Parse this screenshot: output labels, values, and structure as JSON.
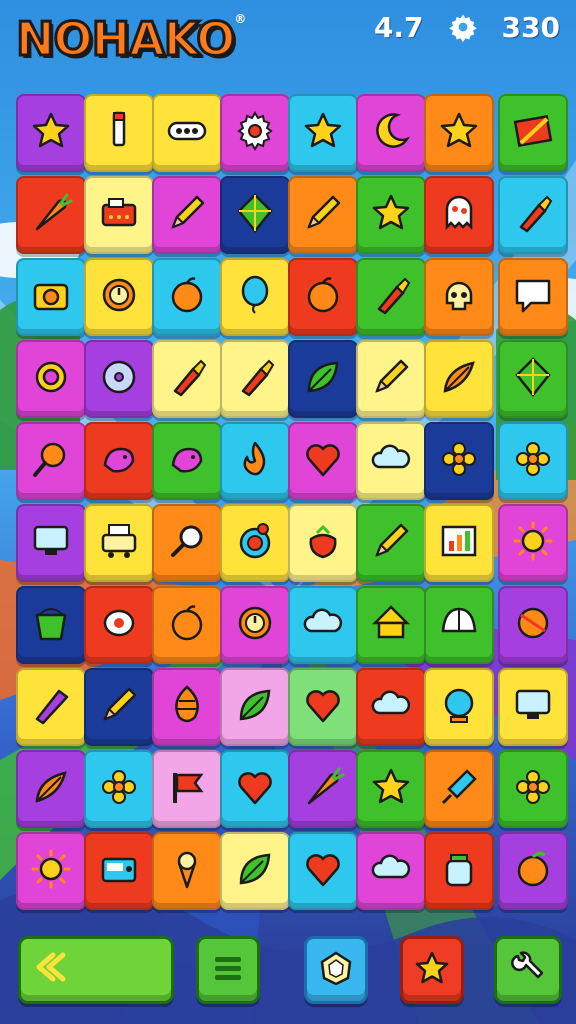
{
  "header": {
    "logo_text": "NOHAKO",
    "logo_mark": "®",
    "rating": "4.7",
    "score": "330",
    "settings_icon": "gear-icon"
  },
  "colors": {
    "purple": "#a63fe0",
    "yellow": "#ffe23a",
    "teal": "#2ec7ee",
    "orange": "#ff8a18",
    "green": "#3fc12c",
    "red": "#ee3a1f",
    "magenta": "#e045d8",
    "navy": "#1b3b9a",
    "pale": "#fff48a",
    "pink": "#f2a6e8",
    "lightgreen": "#7fe07a"
  },
  "board": {
    "rows": [
      [
        "star",
        "pencil-yellow",
        "dots",
        "gear",
        "star",
        "moon",
        "star",
        "dash-pencil"
      ],
      [
        "carrot",
        "box",
        "pencil",
        "kite",
        "pencil",
        "star",
        "ghost",
        "brush"
      ],
      [
        "camera",
        "clock",
        "apple",
        "balloon",
        "apple",
        "brush",
        "skull",
        "speech"
      ],
      [
        "ring",
        "cd",
        "brush",
        "brush",
        "leaf",
        "pencil",
        "feather",
        "kite"
      ],
      [
        "racket",
        "bird",
        "bird",
        "flame",
        "heart",
        "cloud",
        "flower",
        "flower"
      ],
      [
        "monitor",
        "printer",
        "magnifier",
        "target",
        "berry",
        "pencil",
        "chart",
        "sun"
      ],
      [
        "bucket",
        "egg",
        "apple",
        "clock",
        "cloud",
        "house",
        "shell",
        "ball"
      ],
      [
        "crayon",
        "pencil",
        "pinecone",
        "leaf",
        "heart",
        "cloud",
        "globe",
        "monitor"
      ],
      [
        "feather",
        "flower",
        "flag",
        "heart",
        "carrot",
        "star",
        "pin",
        "flower"
      ],
      [
        "sun",
        "radio",
        "icecream",
        "leaf",
        "heart",
        "cloud",
        "jar",
        "orange"
      ]
    ]
  },
  "toolbar": {
    "back_icon": "back-arrows-icon",
    "menu_icon": "menu-icon",
    "shuffle_icon": "gem-icon",
    "hint_icon": "star-icon",
    "tools_icon": "wrench-icon"
  }
}
